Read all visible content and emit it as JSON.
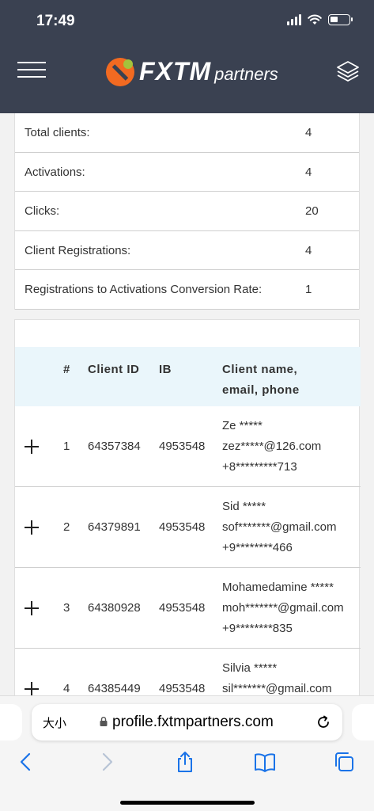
{
  "status": {
    "time": "17:49"
  },
  "header": {
    "brand": "FXTM",
    "brand_sub": "partners"
  },
  "stats": [
    {
      "label": "Total clients:",
      "value": "4"
    },
    {
      "label": "Activations:",
      "value": "4"
    },
    {
      "label": "Clicks:",
      "value": "20"
    },
    {
      "label": "Client Registrations:",
      "value": "4"
    },
    {
      "label": "Registrations to Activations Conversion Rate:",
      "value": "1"
    }
  ],
  "table": {
    "headers": {
      "num": "#",
      "client_id": "Client ID",
      "ib": "IB",
      "name1": "Client name,",
      "name2": "email, phone"
    },
    "rows": [
      {
        "num": "1",
        "client_id": "64357384",
        "ib": "4953548",
        "name": "Ze *****",
        "email": "zez*****@126.com",
        "phone": "+8*********713"
      },
      {
        "num": "2",
        "client_id": "64379891",
        "ib": "4953548",
        "name": "Sid *****",
        "email": "sof*******@gmail.com",
        "phone": "+9********466"
      },
      {
        "num": "3",
        "client_id": "64380928",
        "ib": "4953548",
        "name": "Mohamedamine *****",
        "email": "moh*******@gmail.com",
        "phone": "+9********835"
      },
      {
        "num": "4",
        "client_id": "64385449",
        "ib": "4953548",
        "name": "Silvia *****",
        "email": "sil*******@gmail.com",
        "phone": ""
      }
    ]
  },
  "browser": {
    "text_size_label": "大小",
    "url": "profile.fxtmpartners.com"
  }
}
